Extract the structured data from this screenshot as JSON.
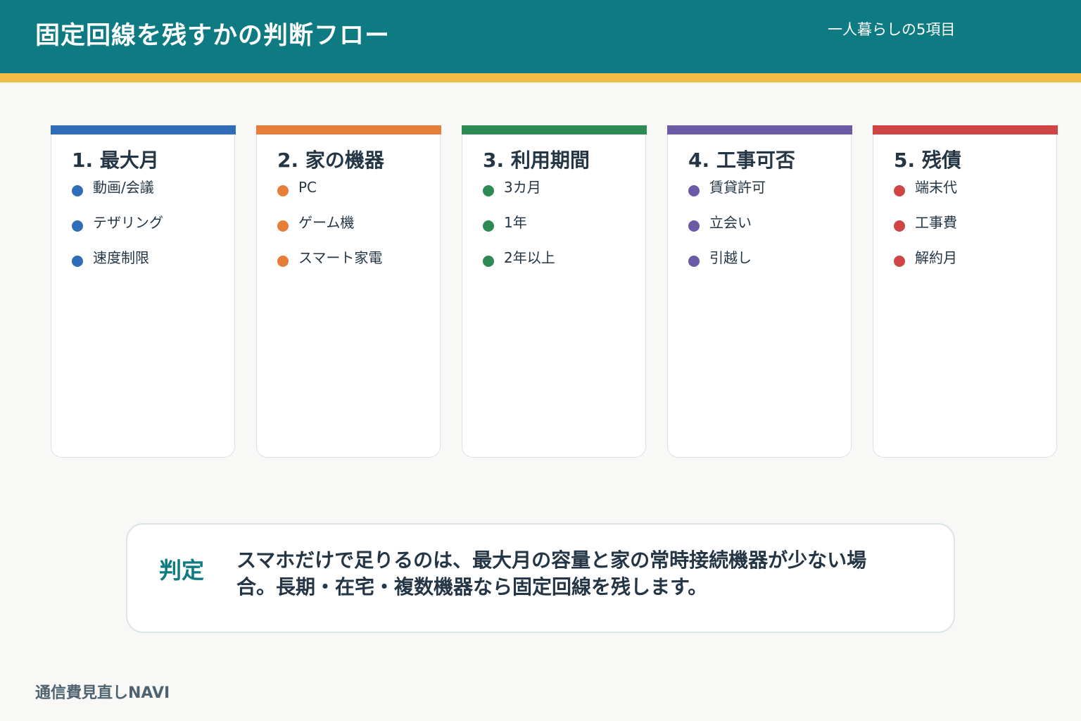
{
  "header": {
    "title": "固定回線を残すかの判断フロー",
    "subtitle": "一人暮らしの5項目"
  },
  "cards": [
    {
      "title": "1. 最大月",
      "color": "#2f6db8",
      "items": [
        "動画/会議",
        "テザリング",
        "速度制限"
      ]
    },
    {
      "title": "2. 家の機器",
      "color": "#e67e3a",
      "items": [
        "PC",
        "ゲーム機",
        "スマート家電"
      ]
    },
    {
      "title": "3. 利用期間",
      "color": "#2d8a55",
      "items": [
        "3カ月",
        "1年",
        "2年以上"
      ]
    },
    {
      "title": "4. 工事可否",
      "color": "#6b5aa6",
      "items": [
        "賃貸許可",
        "立会い",
        "引越し"
      ]
    },
    {
      "title": "5. 残債",
      "color": "#cf4545",
      "items": [
        "端末代",
        "工事費",
        "解約月"
      ]
    }
  ],
  "verdict": {
    "label": "判定",
    "text": "スマホだけで足りるのは、最大月の容量と家の常時接続機器が少ない場合。長期・在宅・複数機器なら固定回線を残します。"
  },
  "footer": {
    "brand": "通信費見直しNAVI"
  }
}
